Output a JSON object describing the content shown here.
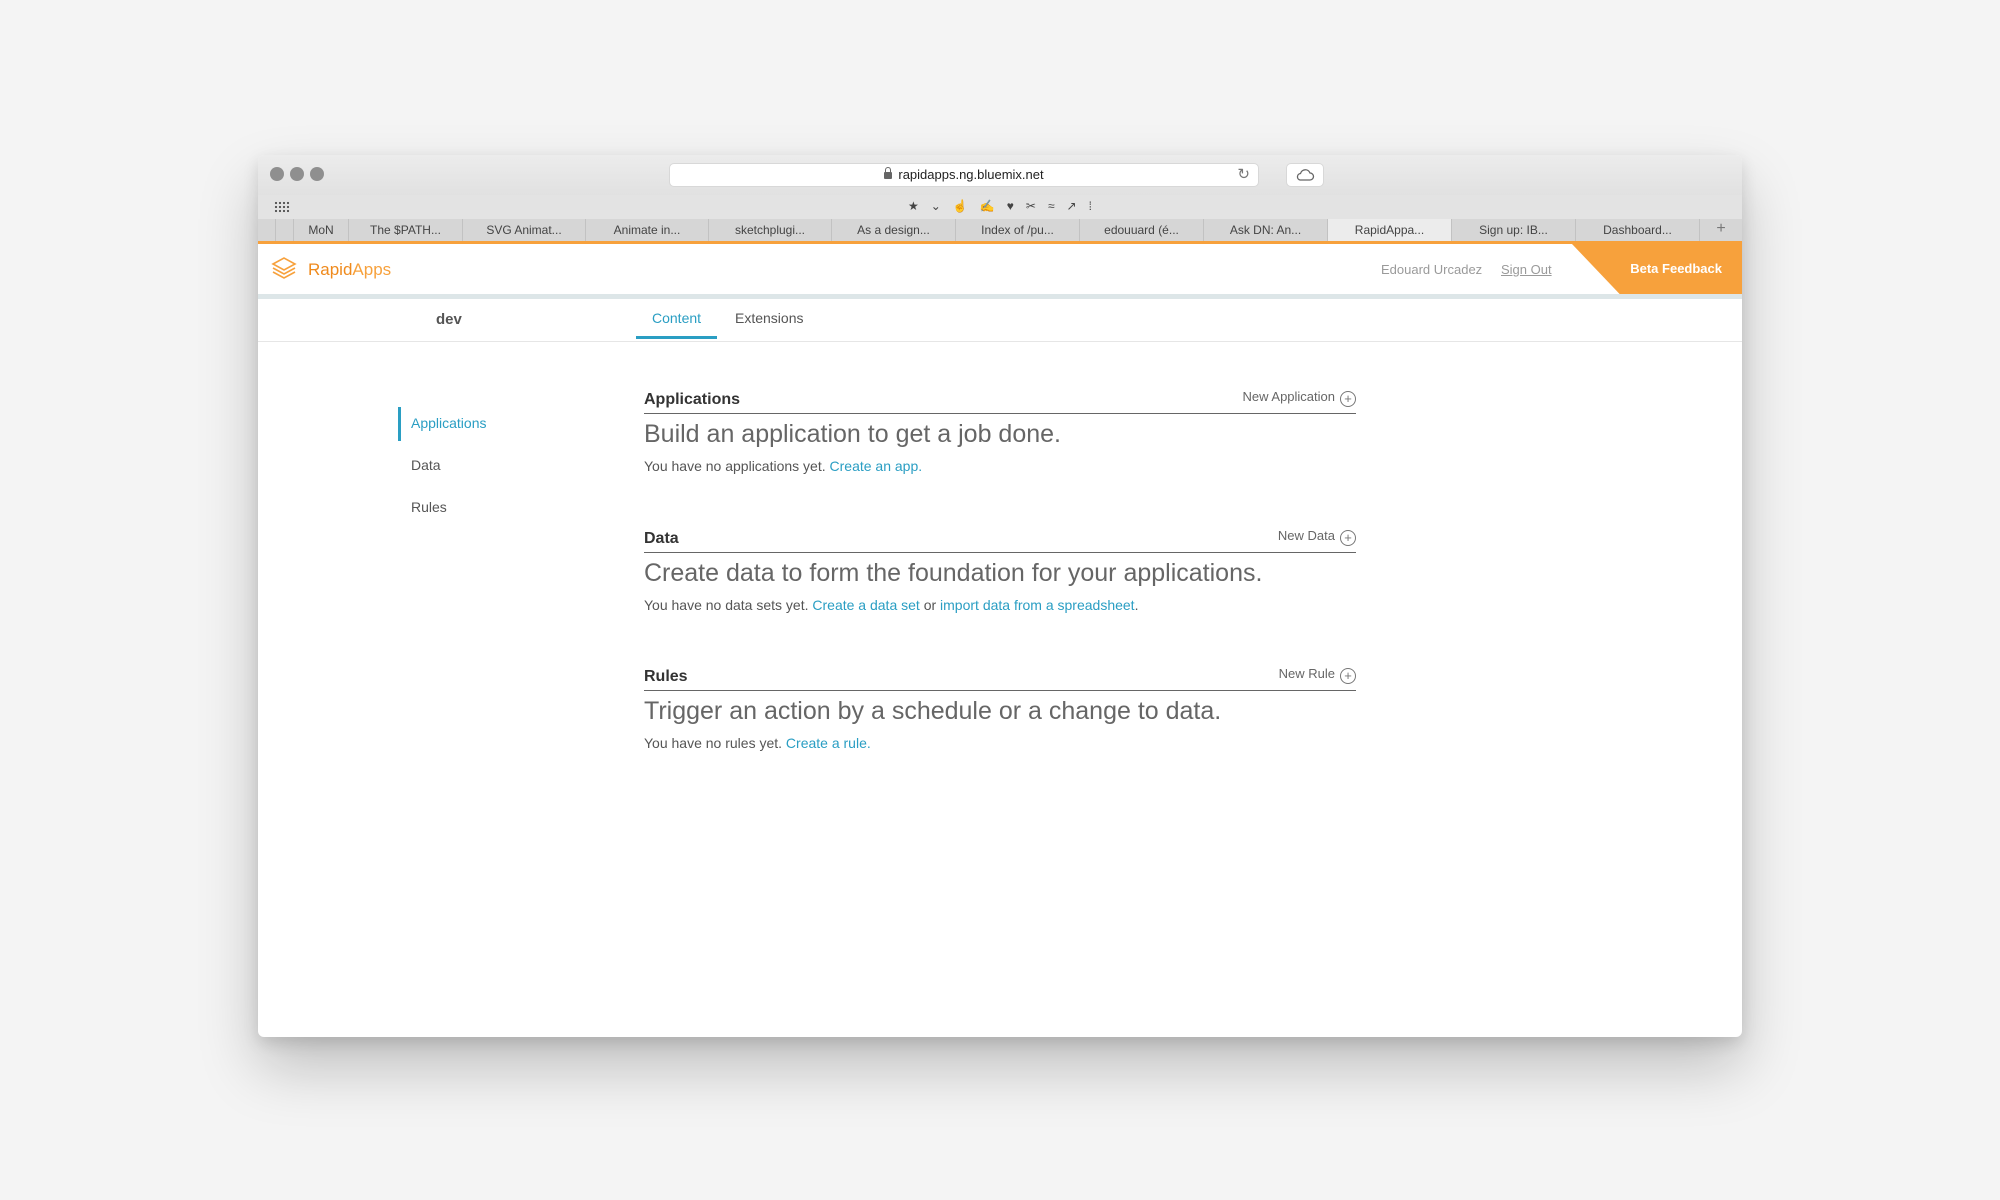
{
  "browser": {
    "url": "rapidapps.ng.bluemix.net",
    "bookmark_icons": [
      "★",
      "⌄",
      "☝",
      "✍",
      "♥",
      "✂",
      "≈",
      "↗",
      "⁞"
    ],
    "tabs": [
      {
        "label": "",
        "width": 18
      },
      {
        "label": "",
        "width": 18
      },
      {
        "label": "MoN",
        "width": 55
      },
      {
        "label": "The $PATH...",
        "width": 114
      },
      {
        "label": "SVG Animat...",
        "width": 123
      },
      {
        "label": "Animate in...",
        "width": 123
      },
      {
        "label": "sketchplugi...",
        "width": 123
      },
      {
        "label": "As a design...",
        "width": 124
      },
      {
        "label": "Index of /pu...",
        "width": 124
      },
      {
        "label": "edouuard (é...",
        "width": 124
      },
      {
        "label": "Ask DN: An...",
        "width": 124
      },
      {
        "label": "RapidAppa...",
        "width": 124,
        "active": true
      },
      {
        "label": "Sign up: IB...",
        "width": 124
      },
      {
        "label": "Dashboard...",
        "width": 124
      }
    ],
    "new_tab": "+"
  },
  "header": {
    "brand_rapid": "Rapid",
    "brand_apps": "Apps",
    "username": "Edouard Urcadez",
    "signout": "Sign Out",
    "beta": "Beta Feedback",
    "accent_color": "#f7a13c"
  },
  "subnav": {
    "workspace": "dev",
    "tabs": [
      "Content",
      "Extensions"
    ]
  },
  "sidebar": {
    "items": [
      "Applications",
      "Data",
      "Rules"
    ]
  },
  "sections": {
    "applications": {
      "title": "Applications",
      "new_label": "New Application",
      "headline": "Build an application to get a job done.",
      "text": "You have no applications yet.",
      "link": "Create an app."
    },
    "data": {
      "title": "Data",
      "new_label": "New Data",
      "headline": "Create data to form the foundation for your applications.",
      "text": "You have no data sets yet.",
      "link1": "Create a data set",
      "middle": "or",
      "link2": "import data from a spreadsheet",
      "end": "."
    },
    "rules": {
      "title": "Rules",
      "new_label": "New Rule",
      "headline": "Trigger an action by a schedule or a change to data.",
      "text": "You have no rules yet.",
      "link": "Create a rule."
    }
  }
}
